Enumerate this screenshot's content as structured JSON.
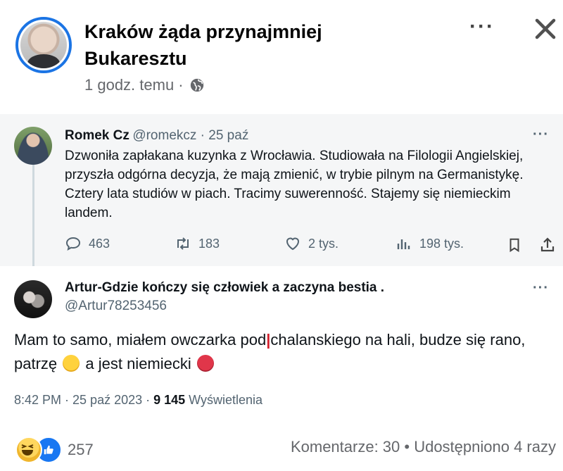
{
  "post": {
    "title": "Kraków żąda przynajmniej Bukaresztu",
    "time": "1 godz. temu ·",
    "more_icon": "more-dots-icon",
    "close_icon": "close-icon"
  },
  "tweet": {
    "author": "Romek Cz",
    "handle_date": "@romekcz · 25 paź",
    "text": "Dzwoniła zapłakana kuzynka z Wrocławia. Studiowała na Filologii Angielskiej, przyszła odgórna decyzja, że mają zmienić, w trybie pilnym na Germanistykę. Cztery lata studiów w piach. Tracimy suwerenność. Stajemy się niemieckim landem.",
    "replies": "463",
    "retweets": "183",
    "likes": "2 tys.",
    "views": "198 tys."
  },
  "reply": {
    "author": "Artur-Gdzie kończy się człowiek a zaczyna bestia .",
    "handle": "@Artur78253456",
    "text_part1": "Mam to samo, miałem owczarka pod",
    "text_mark": "|",
    "text_part2": "chalanskiego na hali, budze się rano, patrzę ",
    "text_part3": " a jest niemiecki ",
    "date": "8:42 PM · 25 paź 2023 · ",
    "views_count": "9 145",
    "views_label": " Wyświetlenia"
  },
  "footer": {
    "reaction_count": "257",
    "comments": "Komentarze: 30",
    "separator": " • ",
    "shares": "Udostępniono 4 razy"
  },
  "colors": {
    "facebook_blue": "#1877f2",
    "avatar_ring": "#1b74e4",
    "muted_text": "#65676b",
    "twitter_muted": "#536471"
  }
}
